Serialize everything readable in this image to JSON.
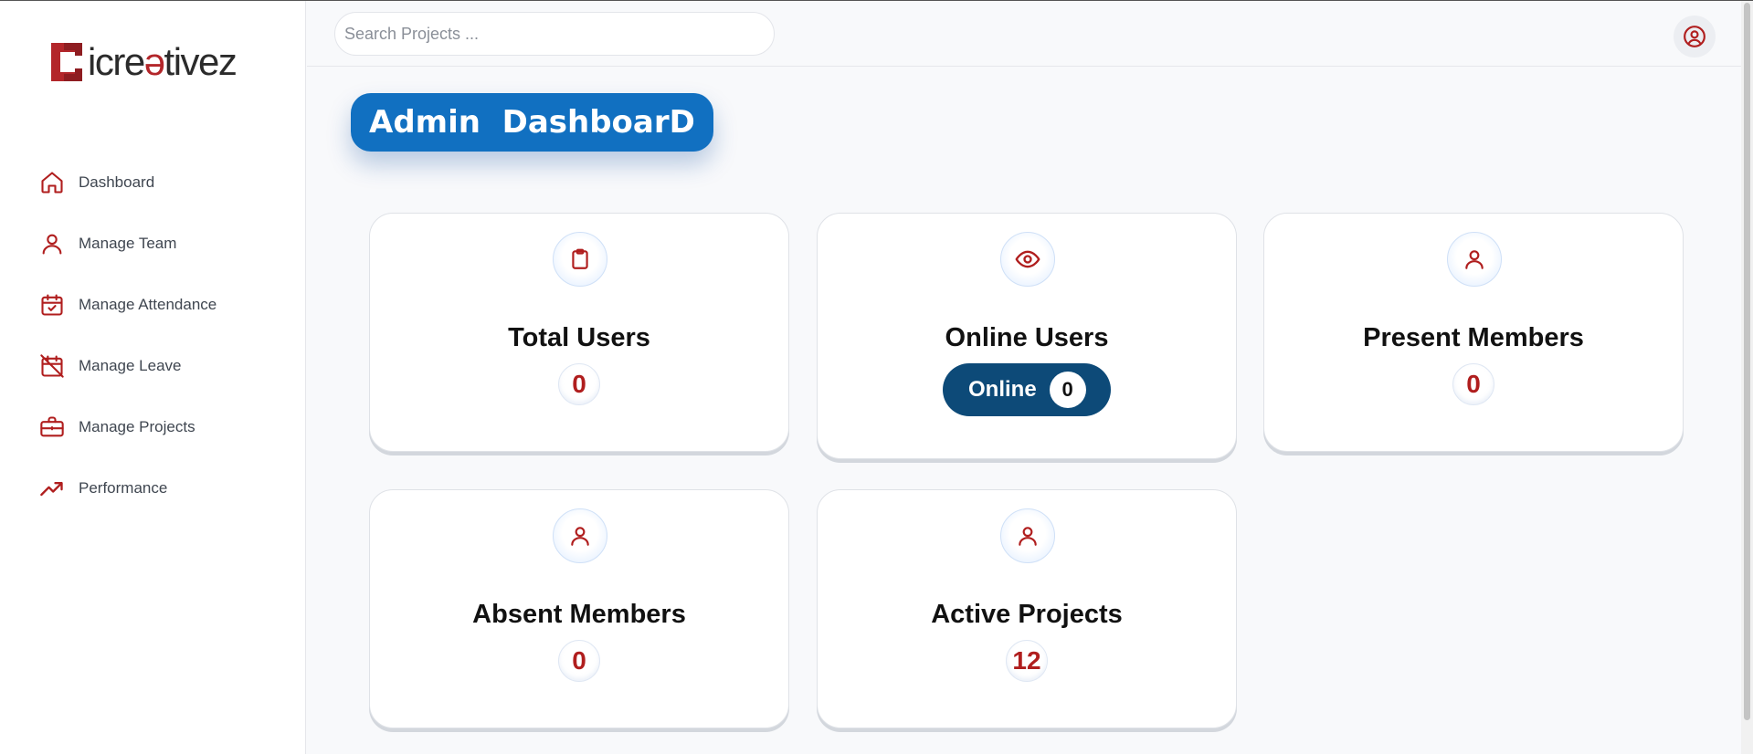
{
  "brand": {
    "name_prefix": "icre",
    "name_accent": "ə",
    "name_suffix": "tivez",
    "primary_color": "#b3262a",
    "dark_color": "#2b2b2b"
  },
  "sidebar": {
    "items": [
      {
        "label": "Dashboard",
        "icon": "home-icon"
      },
      {
        "label": "Manage Team",
        "icon": "user-icon"
      },
      {
        "label": "Manage Attendance",
        "icon": "calendar-check-icon"
      },
      {
        "label": "Manage Leave",
        "icon": "calendar-off-icon"
      },
      {
        "label": "Manage Projects",
        "icon": "briefcase-icon"
      },
      {
        "label": "Performance",
        "icon": "trending-up-icon"
      }
    ]
  },
  "header": {
    "search_placeholder": "Search Projects ...",
    "profile_icon": "user-circle-icon"
  },
  "page": {
    "title": "Admin  DashboarD",
    "title_color": "#1170c1"
  },
  "cards": {
    "total_users": {
      "title": "Total Users",
      "value": "0",
      "icon": "clipboard-icon"
    },
    "online_users": {
      "title": "Online Users",
      "badge_label": "Online",
      "value": "0",
      "icon": "eye-icon",
      "badge_color": "#0d4a78"
    },
    "present_members": {
      "title": "Present Members",
      "value": "0",
      "icon": "user-icon"
    },
    "absent_members": {
      "title": "Absent Members",
      "value": "0",
      "icon": "user-icon"
    },
    "active_projects": {
      "title": "Active Projects",
      "value": "12",
      "icon": "user-icon"
    }
  },
  "accent_red": "#b01e1e"
}
